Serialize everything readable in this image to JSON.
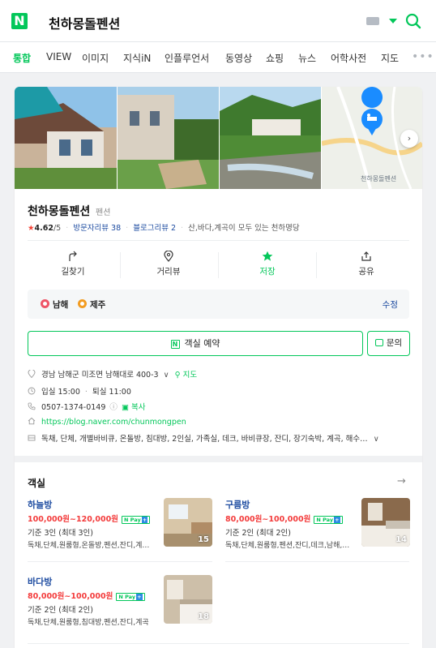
{
  "header": {
    "logo": "N",
    "query": "천하몽돌펜션",
    "brand_color": "#03c75a"
  },
  "tabs": [
    {
      "label": "통합",
      "active": true
    },
    {
      "label": "VIEW"
    },
    {
      "label": "이미지"
    },
    {
      "label": "지식iN"
    },
    {
      "label": "인플루언서"
    },
    {
      "label": "동영상"
    },
    {
      "label": "쇼핑"
    },
    {
      "label": "뉴스"
    },
    {
      "label": "어학사전"
    },
    {
      "label": "지도"
    }
  ],
  "tab_more": "•••",
  "place": {
    "name": "천하몽돌펜션",
    "category": "펜션",
    "star": "★",
    "rating": "4.62",
    "rating_max": "/5",
    "visitor_reviews": "방문자리뷰 38",
    "blog_reviews": "블로그리뷰 2",
    "tagline": "산,바다,계곡이 모두 있는 천하명당",
    "photo_next": "›",
    "map_label": "천하몽돌펜션"
  },
  "actions": [
    {
      "label": "길찾기",
      "icon": "directions-icon"
    },
    {
      "label": "거리뷰",
      "icon": "streetview-icon"
    },
    {
      "label": "저장",
      "icon": "star-icon"
    },
    {
      "label": "공유",
      "icon": "share-icon"
    }
  ],
  "regions": [
    {
      "label": "남해",
      "color": "#ee5467"
    },
    {
      "label": "제주",
      "color": "#f29c21"
    }
  ],
  "region_edit": "수정",
  "buttons": {
    "reserve_badge": "N",
    "reserve": "객실 예약",
    "inquiry": "문의"
  },
  "info": {
    "address": "경남 남해군 미조면 남해대로 400-3",
    "address_chevron": "∨",
    "map_link": "지도",
    "checkin": "입실 15:00",
    "checkout": "퇴실 11:00",
    "separator": "·",
    "phone": "0507-1374-0149",
    "copy": "복사",
    "website": "https://blog.naver.com/chunmongpen",
    "amenities": "독채, 단체, 개별바비큐, 온돌방, 침대방, 2인실, 가족실, 데크, 바비큐장, 잔디, 장기숙박, 계곡, 해수…"
  },
  "rooms_section": {
    "title": "객실",
    "arrow": "→"
  },
  "npay": {
    "label": "N Pay",
    "plus": "+"
  },
  "rooms": [
    {
      "name": "하늘방",
      "price": "100,000원~120,000원",
      "capacity": "기준 3인 (최대 3인)",
      "tags": "독채,단체,원룸형,온돌방,펜션,잔디,계곡,해수욕장",
      "photo_count": "15"
    },
    {
      "name": "구름방",
      "price": "80,000원~100,000원",
      "capacity": "기준 2인 (최대 2인)",
      "tags": "독채,단체,원룸형,펜션,잔디,데크,남해,계곡",
      "photo_count": "14"
    },
    {
      "name": "바다방",
      "price": "80,000원~100,000원",
      "capacity": "기준 2인 (최대 2인)",
      "tags": "독채,단체,원룸형,침대방,펜션,잔디,계곡",
      "photo_count": "18"
    }
  ]
}
